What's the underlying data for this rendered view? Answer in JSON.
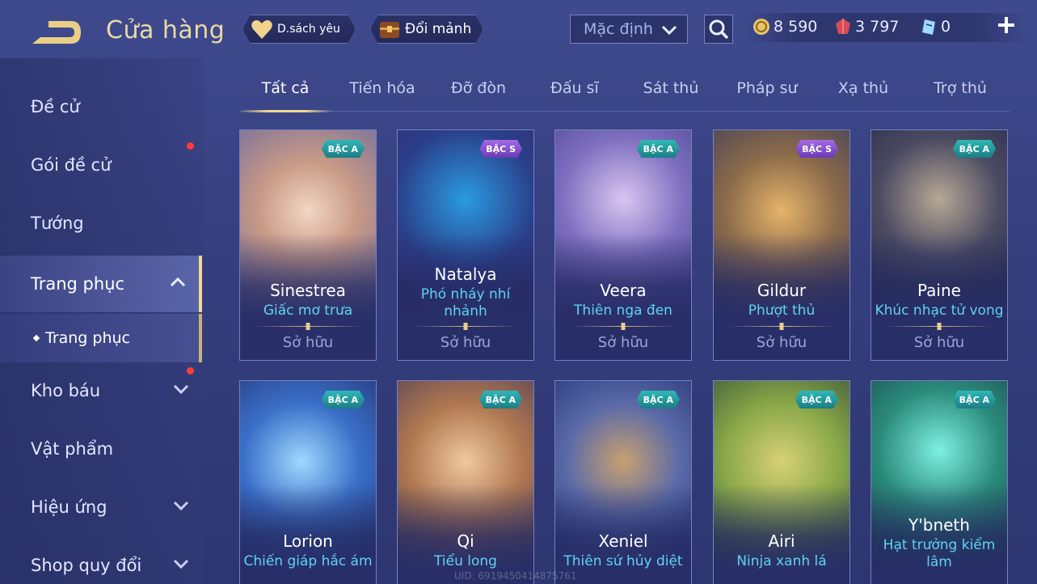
{
  "header": {
    "title": "Cửa hàng",
    "wishlist_label": "D.sách yêu",
    "exchange_label": "Đổi mảnh",
    "sort_selected": "Mặc định",
    "currency": {
      "gold": "8 590",
      "ruby": "3 797",
      "voucher": "0"
    }
  },
  "sidebar": {
    "items": [
      {
        "label": "Đề cử"
      },
      {
        "label": "Gói đề cử"
      },
      {
        "label": "Tướng"
      },
      {
        "label": "Trang phục"
      },
      {
        "label": "Trang phục"
      },
      {
        "label": "Kho báu"
      },
      {
        "label": "Vật phẩm"
      },
      {
        "label": "Hiệu ứng"
      },
      {
        "label": "Shop quy đổi"
      }
    ]
  },
  "tabs": [
    "Tất cả",
    "Tiến hóa",
    "Đỡ đòn",
    "Đấu sĩ",
    "Sát thủ",
    "Pháp sư",
    "Xạ thủ",
    "Trợ thủ"
  ],
  "cards": [
    {
      "hero": "Sinestrea",
      "skin": "Giấc mơ trưa",
      "tier": "BẬC A",
      "status": "Sở hữu"
    },
    {
      "hero": "Natalya",
      "skin": "Phó nháy nhí nhảnh",
      "tier": "BẬC S",
      "status": "Sở hữu"
    },
    {
      "hero": "Veera",
      "skin": "Thiên nga đen",
      "tier": "BẬC A",
      "status": "Sở hữu"
    },
    {
      "hero": "Gildur",
      "skin": "Phượt thủ",
      "tier": "BẬC S",
      "status": "Sở hữu"
    },
    {
      "hero": "Paine",
      "skin": "Khúc nhạc tử vong",
      "tier": "BẬC A",
      "status": "Sở hữu"
    },
    {
      "hero": "Lorion",
      "skin": "Chiến giáp hắc ám",
      "tier": "BẬC A"
    },
    {
      "hero": "Qi",
      "skin": "Tiểu long",
      "tier": "BẬC A"
    },
    {
      "hero": "Xeniel",
      "skin": "Thiên sứ hủy diệt",
      "tier": "BẬC A"
    },
    {
      "hero": "Airi",
      "skin": "Ninja xanh lá",
      "tier": "BẬC A"
    },
    {
      "hero": "Y'bneth",
      "skin": "Hạt trưởng kiểm lâm",
      "tier": "BẬC A"
    }
  ],
  "footer": {
    "uid": "UID: 6919450414875761"
  },
  "colors": {
    "background": "#3a4488",
    "title_gold": "#e9d9a6",
    "skin_name": "#5fd3f0",
    "tier_a": "#2fb7b5",
    "tier_s": "#a46ae5",
    "notification": "#ff3b3b"
  }
}
